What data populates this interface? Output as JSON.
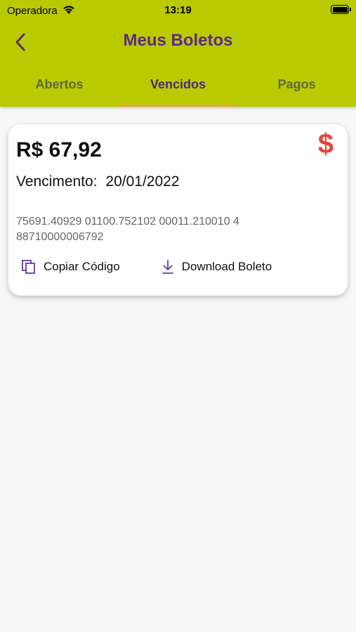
{
  "status_bar": {
    "carrier": "Operadora",
    "time": "13:19"
  },
  "nav": {
    "title": "Meus Boletos",
    "back_icon": "chevron-left-icon"
  },
  "tabs": [
    {
      "label": "Abertos",
      "active": false
    },
    {
      "label": "Vencidos",
      "active": true
    },
    {
      "label": "Pagos",
      "active": false
    }
  ],
  "boleto": {
    "amount": "R$ 67,92",
    "due_label": "Vencimento:",
    "due_date": "20/01/2022",
    "barcode_line1": "75691.40929 01100.752102 00011.210010 4",
    "barcode_line2": "88710000006792",
    "status_icon": "$",
    "copy_label": "Copiar Código",
    "download_label": "Download Boleto"
  },
  "colors": {
    "header_bg": "#b9cb00",
    "title": "#5b2a86",
    "tab_indicator": "#e9a23b",
    "dollar": "#e8423a",
    "background": "#f7f7f7"
  }
}
